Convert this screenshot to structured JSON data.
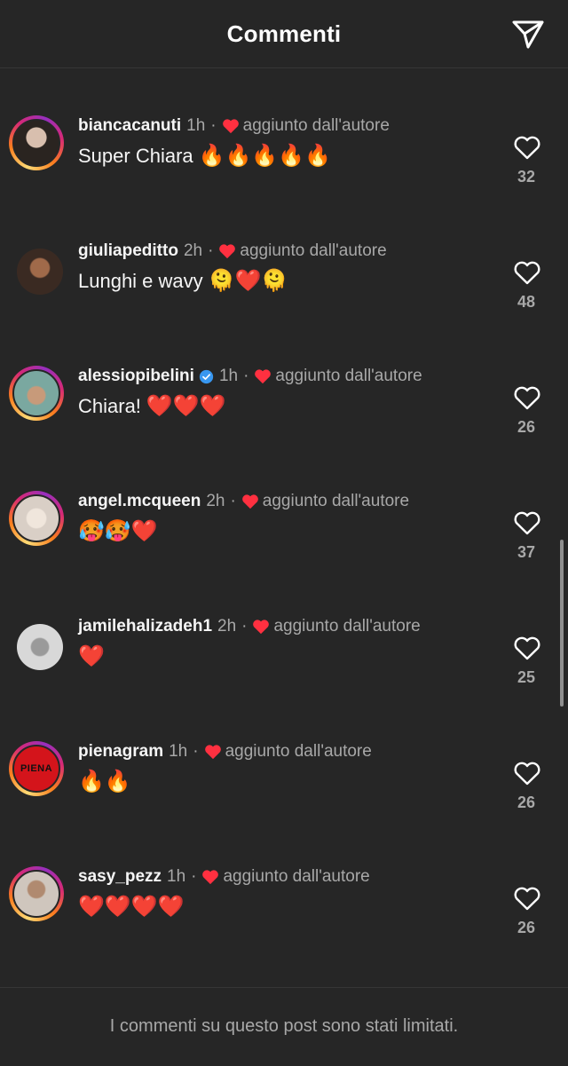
{
  "header": {
    "title": "Commenti",
    "send_icon": "send-icon"
  },
  "comments": [
    {
      "username": "biancacanuti",
      "time": "1h",
      "dot": "·",
      "liked_by": "aggiunto dall'autore",
      "text": "Super Chiara",
      "emojis": "🔥🔥🔥🔥🔥",
      "likes": "32"
    },
    {
      "username": "giuliapeditto",
      "time": "2h",
      "dot": "·",
      "liked_by": "aggiunto dall'autore",
      "text": "Lunghi e wavy",
      "emojis": "🫠❤️🫠",
      "likes": "48"
    },
    {
      "username": "alessiopibelini",
      "time": "1h",
      "dot": "·",
      "liked_by": "aggiunto dall'autore",
      "text": "Chiara!",
      "emojis": "❤️❤️❤️",
      "likes": "26",
      "verified": true
    },
    {
      "username": "angel.mcqueen",
      "time": "2h",
      "dot": "·",
      "liked_by": "aggiunto dall'autore",
      "text": "",
      "emojis": "🥵🥵❤️",
      "likes": "37"
    },
    {
      "username": "jamilehalizadeh1",
      "time": "2h",
      "dot": "·",
      "liked_by": "aggiunto dall'autore",
      "text": "",
      "emojis": "❤️",
      "likes": "25"
    },
    {
      "username": "pienagram",
      "time": "1h",
      "dot": "·",
      "liked_by": "aggiunto dall'autore",
      "text": "",
      "emojis": "🔥🔥",
      "likes": "26",
      "avatar_text": "PIENA"
    },
    {
      "username": "sasy_pezz",
      "time": "1h",
      "dot": "·",
      "liked_by": "aggiunto dall'autore",
      "text": "",
      "emojis": "❤️❤️❤️❤️",
      "likes": "26"
    }
  ],
  "footer": {
    "notice": "I commenti su questo post sono stati limitati."
  },
  "colors": {
    "background": "#262626",
    "heart_red": "#ff3040",
    "muted": "#a8a8a8",
    "verified_blue": "#3897f0"
  }
}
